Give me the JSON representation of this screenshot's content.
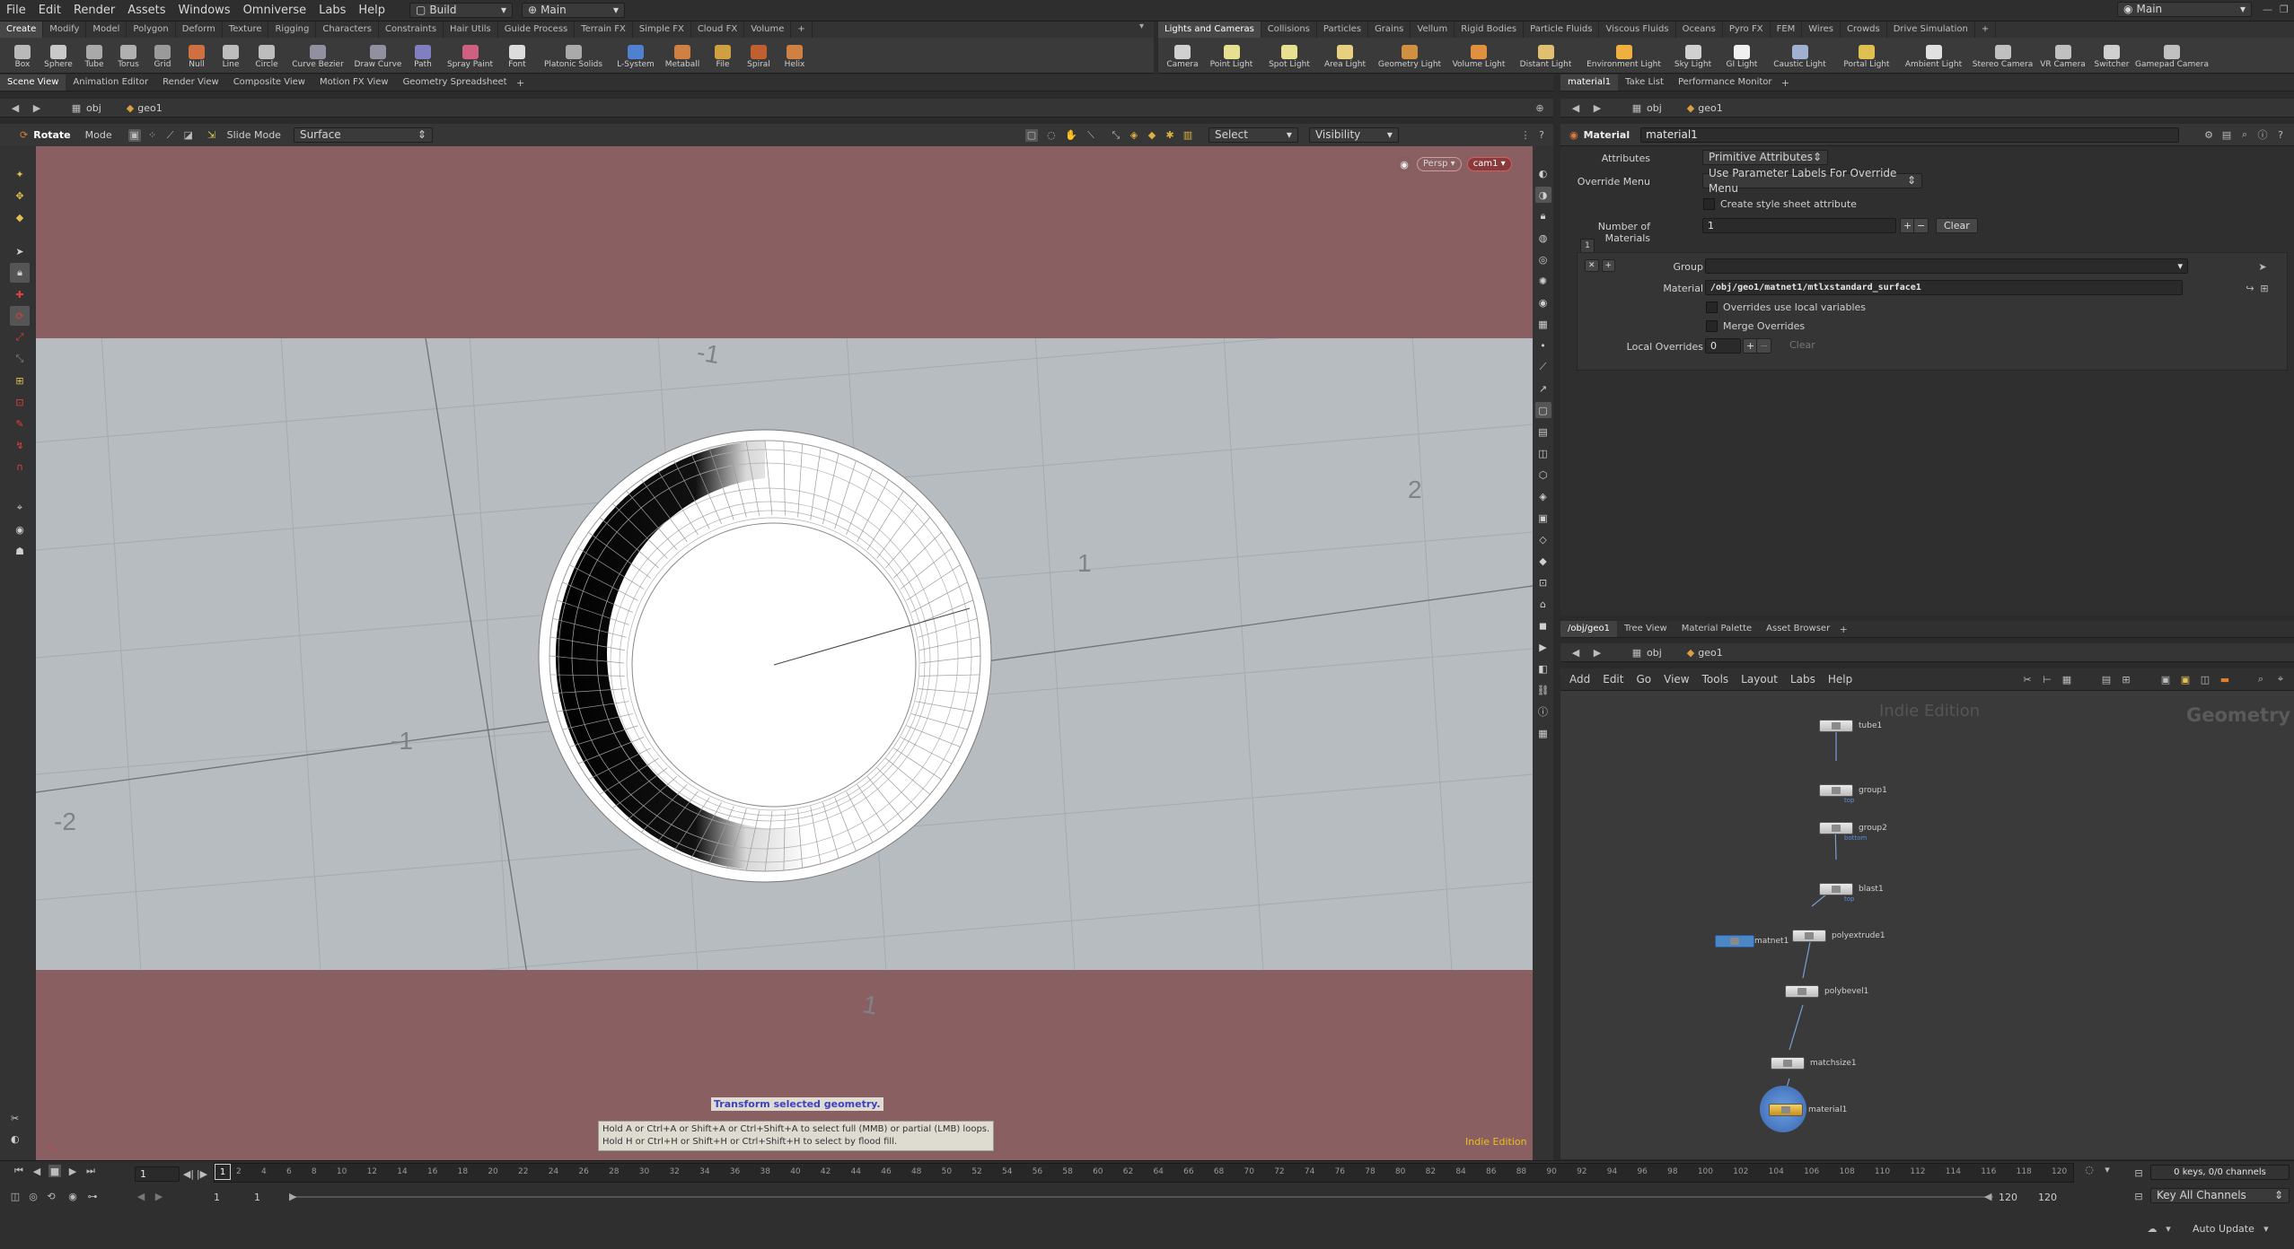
{
  "menu": {
    "items": [
      "File",
      "Edit",
      "Render",
      "Assets",
      "Windows",
      "Omniverse",
      "Labs",
      "Help"
    ],
    "desktop": "Build",
    "update_mode": "Main",
    "main_right": "Main"
  },
  "shelf_left": {
    "tabs": [
      "Create",
      "Modify",
      "Model",
      "Polygon",
      "Deform",
      "Texture",
      "Rigging",
      "Characters",
      "Constraints",
      "Hair Utils",
      "Guide Process",
      "Terrain FX",
      "Simple FX",
      "Cloud FX",
      "Volume"
    ],
    "tools": [
      "Box",
      "Sphere",
      "Tube",
      "Torus",
      "Grid",
      "Null",
      "Line",
      "Circle",
      "Curve Bezier",
      "Draw Curve",
      "Path",
      "Spray Paint",
      "Font",
      "Platonic Solids",
      "L-System",
      "Metaball",
      "File",
      "Spiral",
      "Helix"
    ]
  },
  "shelf_right": {
    "tabs": [
      "Lights and Cameras",
      "Collisions",
      "Particles",
      "Grains",
      "Vellum",
      "Rigid Bodies",
      "Particle Fluids",
      "Viscous Fluids",
      "Oceans",
      "Pyro FX",
      "FEM",
      "Wires",
      "Crowds",
      "Drive Simulation"
    ],
    "tools": [
      "Camera",
      "Point Light",
      "Spot Light",
      "Area Light",
      "Geometry Light",
      "Volume Light",
      "Distant Light",
      "Environment Light",
      "Sky Light",
      "GI Light",
      "Caustic Light",
      "Portal Light",
      "Ambient Light",
      "Stereo Camera",
      "VR Camera",
      "Switcher",
      "Gamepad Camera"
    ]
  },
  "viewer": {
    "tabs": [
      "Scene View",
      "Animation Editor",
      "Render View",
      "Composite View",
      "Motion FX View",
      "Geometry Spreadsheet"
    ],
    "path_obj": "obj",
    "path_geo": "geo1",
    "tool_name": "Rotate",
    "mode_label": "Mode",
    "slide_mode_label": "Slide Mode",
    "slide_mode_value": "Surface",
    "select_label": "Select",
    "visibility_label": "Visibility",
    "persp": "Persp",
    "cam": "cam1",
    "grid_labels": [
      "-1",
      "2",
      "1",
      "-1",
      "-2",
      "1"
    ],
    "hint_title": "Transform selected geometry.",
    "hint_line1": "Hold A or Ctrl+A or Shift+A or Ctrl+Shift+A to select full (MMB) or partial (LMB) loops.",
    "hint_line2": "Hold H or Ctrl+H or Shift+H or Ctrl+Shift+H to select by flood fill.",
    "edition": "Indie Edition"
  },
  "params": {
    "tabs": [
      "material1",
      "Take List",
      "Performance Monitor"
    ],
    "path_obj": "obj",
    "path_geo": "geo1",
    "node_type": "Material",
    "node_name": "material1",
    "attributes_label": "Attributes",
    "attributes_value": "Primitive Attributes",
    "override_menu_label": "Override Menu",
    "override_menu_value": "Use Parameter Labels For Override Menu",
    "style_sheet_label": "Create style sheet attribute",
    "num_materials_label": "Number of Materials",
    "num_materials_value": "1",
    "clear_label": "Clear",
    "block_index": "1",
    "group_label": "Group",
    "group_value": "",
    "material_label": "Material",
    "material_value": "/obj/geo1/matnet1/mtlxstandard_surface1",
    "overrides_local_label": "Overrides use local variables",
    "merge_overrides_label": "Merge Overrides",
    "local_overrides_label": "Local Overrides",
    "local_overrides_value": "0",
    "clear2_label": "Clear"
  },
  "network": {
    "tabs": [
      "/obj/geo1",
      "Tree View",
      "Material Palette",
      "Asset Browser"
    ],
    "path_obj": "obj",
    "path_geo": "geo1",
    "menu": [
      "Add",
      "Edit",
      "Go",
      "View",
      "Tools",
      "Layout",
      "Labs",
      "Help"
    ],
    "watermark": "Indie Edition",
    "context_label": "Geometry",
    "nodes": [
      {
        "name": "tube1",
        "sub": ""
      },
      {
        "name": "group1",
        "sub": "top"
      },
      {
        "name": "group2",
        "sub": "bottom"
      },
      {
        "name": "blast1",
        "sub": "top"
      },
      {
        "name": "polyextrude1",
        "sub": ""
      },
      {
        "name": "matnet1",
        "sub": ""
      },
      {
        "name": "polybevel1",
        "sub": ""
      },
      {
        "name": "matchsize1",
        "sub": ""
      },
      {
        "name": "material1",
        "sub": ""
      }
    ]
  },
  "timeline": {
    "current_frame": "1",
    "frame_marker": "1",
    "start": "1",
    "start2": "1",
    "end": "120",
    "end2": "120",
    "ticks": [
      "1",
      "2",
      "4",
      "6",
      "8",
      "10",
      "12",
      "14",
      "16",
      "18",
      "20",
      "22",
      "24",
      "26",
      "28",
      "30",
      "32",
      "34",
      "36",
      "38",
      "40",
      "42",
      "44",
      "46",
      "48",
      "50",
      "52",
      "54",
      "56",
      "58",
      "60",
      "62",
      "64",
      "66",
      "68",
      "70",
      "72",
      "74",
      "76",
      "78",
      "80",
      "82",
      "84",
      "86",
      "88",
      "90",
      "92",
      "94",
      "96",
      "98",
      "100",
      "102",
      "104",
      "106",
      "108",
      "110",
      "112",
      "114",
      "116",
      "118",
      "120"
    ],
    "keys_label": "0 keys, 0/0 channels",
    "key_all_label": "Key All Channels",
    "auto_update": "Auto Update"
  },
  "colors": {
    "pink_band": "#8a5f62",
    "viewport_bg": "#b6bcc0",
    "selected_node": "#4b86c6"
  }
}
